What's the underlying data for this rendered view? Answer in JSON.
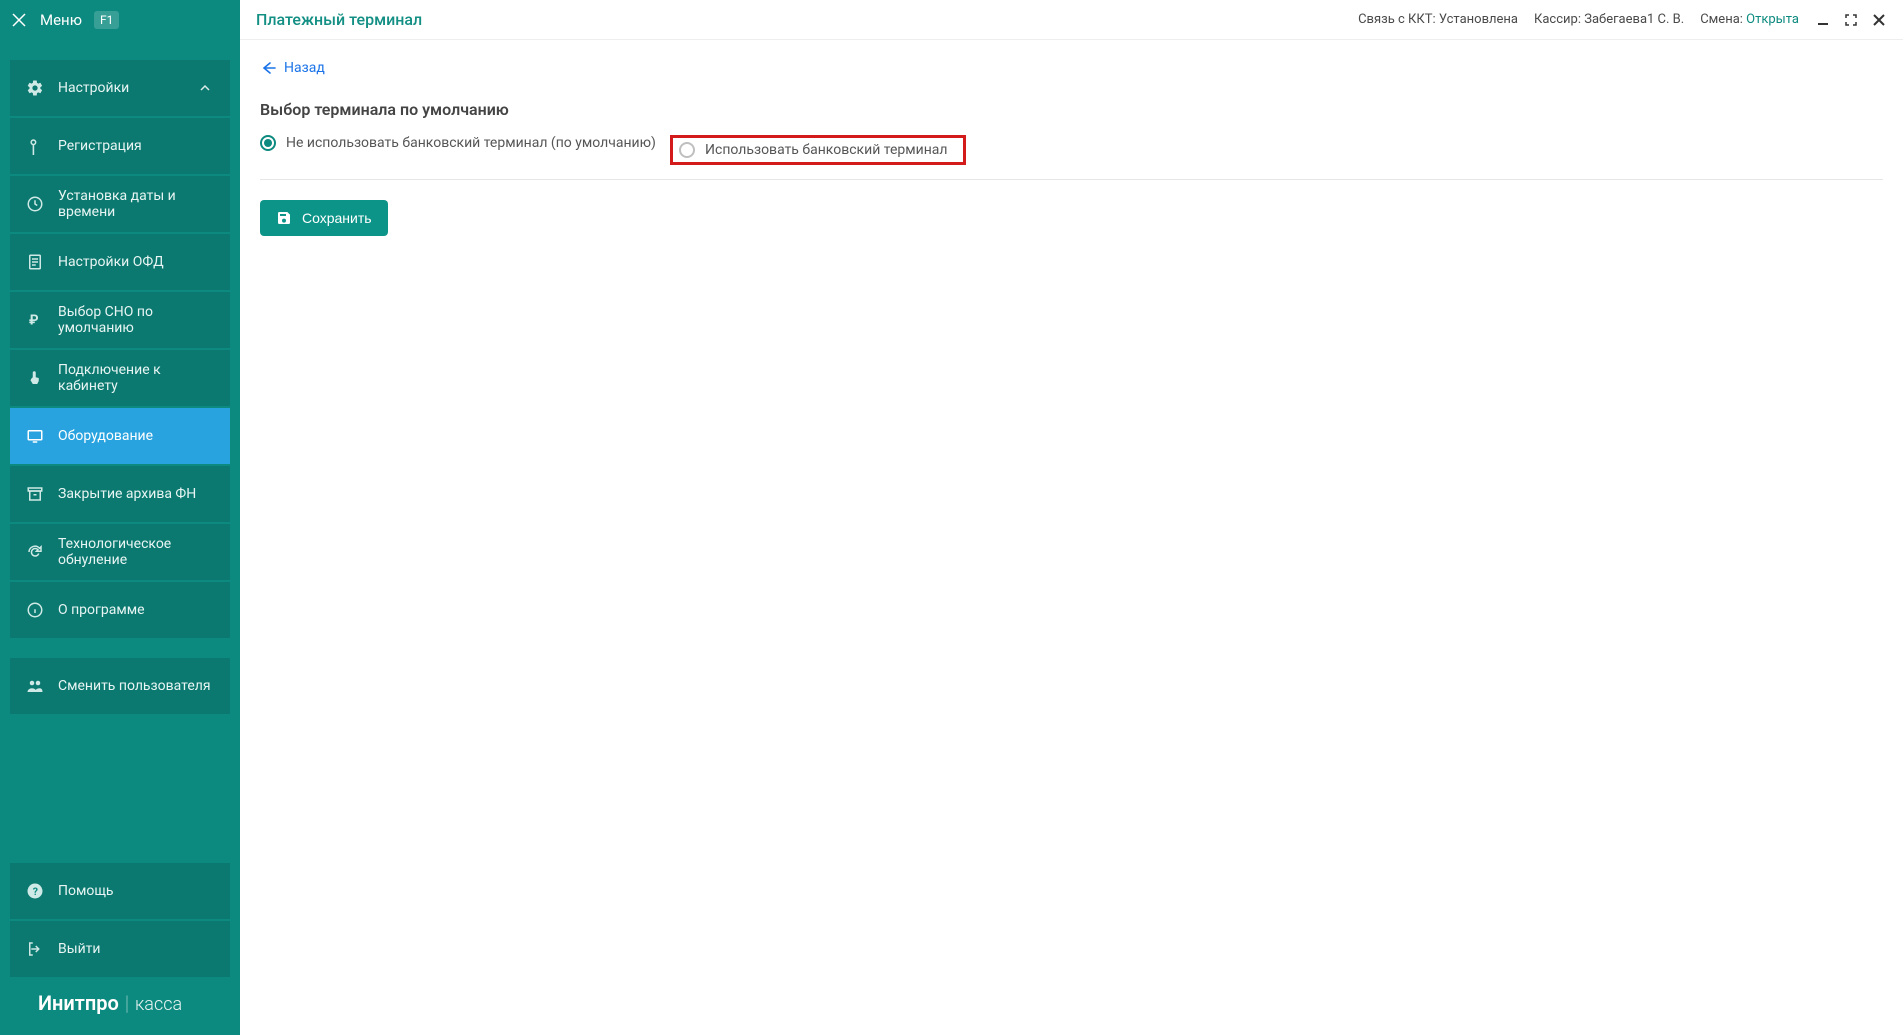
{
  "sidebar": {
    "menu_label": "Меню",
    "f1": "F1",
    "settings_label": "Настройки",
    "items": [
      {
        "label": "Регистрация"
      },
      {
        "label": "Установка даты и времени"
      },
      {
        "label": "Настройки ОФД"
      },
      {
        "label": "Выбор СНО по умолчанию"
      },
      {
        "label": "Подключение к кабинету"
      },
      {
        "label": "Оборудование"
      },
      {
        "label": "Закрытие архива ФН"
      },
      {
        "label": "Технологическое обнуление"
      },
      {
        "label": "О программе"
      }
    ],
    "switch_user": "Сменить пользователя",
    "help": "Помощь",
    "exit": "Выйти",
    "brand_bold": "Инитпро",
    "brand_light": "касса"
  },
  "topbar": {
    "title": "Платежный терминал",
    "kkt_label": "Связь с ККТ:",
    "kkt_value": "Установлена",
    "cashier_label": "Кассир:",
    "cashier_value": "Забегаева1 С. В.",
    "shift_label": "Смена:",
    "shift_value": "Открыта"
  },
  "content": {
    "back": "Назад",
    "heading": "Выбор терминала по умолчанию",
    "opt1": "Не использовать банковский терминал (по умолчанию)",
    "opt2": "Использовать банковский терминал",
    "save": "Сохранить"
  }
}
